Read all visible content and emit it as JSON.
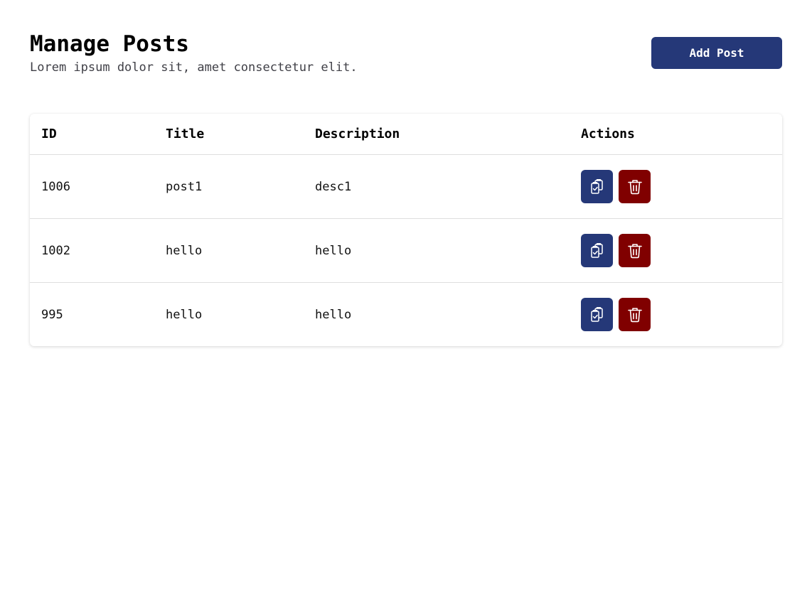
{
  "header": {
    "title": "Manage Posts",
    "subtitle": "Lorem ipsum dolor sit, amet consectetur elit.",
    "add_button_label": "Add Post"
  },
  "table": {
    "columns": [
      "ID",
      "Title",
      "Description",
      "Actions"
    ],
    "rows": [
      {
        "id": "1006",
        "title": "post1",
        "description": "desc1"
      },
      {
        "id": "1002",
        "title": "hello",
        "description": "hello"
      },
      {
        "id": "995",
        "title": "hello",
        "description": "hello"
      }
    ],
    "actions": {
      "copy_icon": "clipboard-copy-icon",
      "delete_icon": "trash-icon"
    }
  },
  "colors": {
    "primary": "#253878",
    "danger": "#800000",
    "text": "#111111",
    "muted": "#3f3f46",
    "border": "#dedede"
  }
}
